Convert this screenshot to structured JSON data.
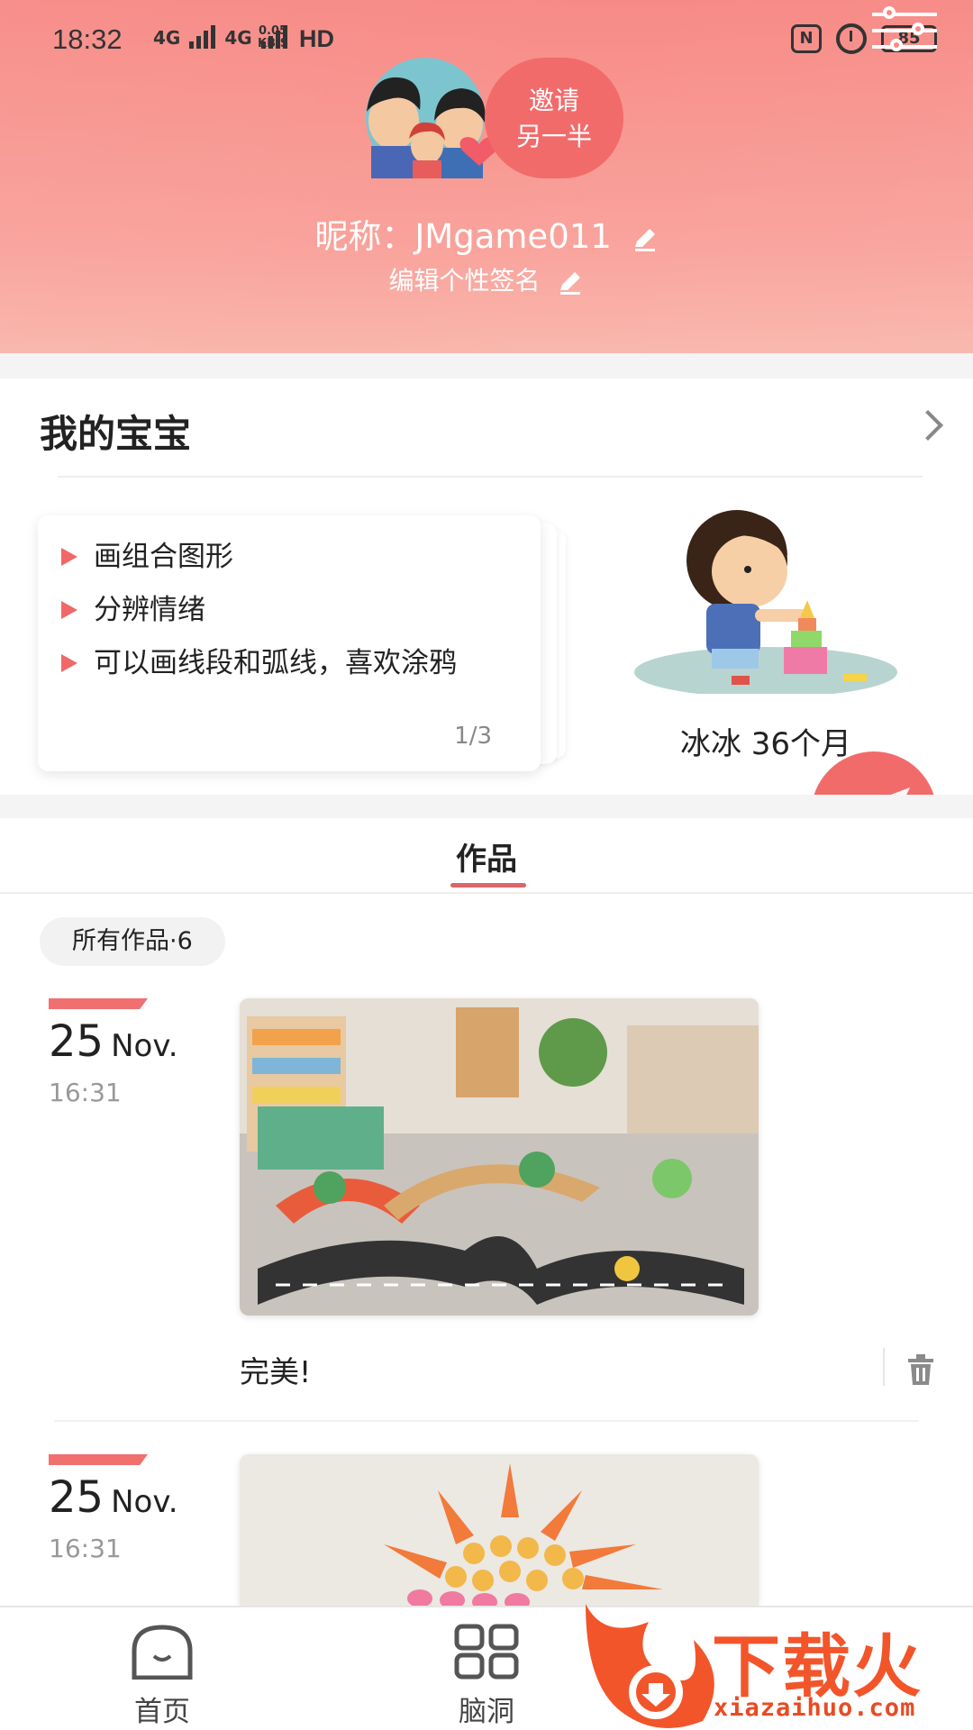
{
  "status_bar": {
    "time": "18:32",
    "network_1": "4G",
    "network_2": "4G",
    "speed_value": "0.05",
    "speed_unit": "KB/S",
    "hd_label": "HD",
    "nfc_label": "N",
    "battery_level": "85"
  },
  "profile": {
    "invite_line1": "邀请",
    "invite_line2": "另一半",
    "nickname": "昵称：JMgame011",
    "signature": "编辑个性签名"
  },
  "baby_section": {
    "title": "我的宝宝",
    "tips": [
      "画组合图形",
      "分辨情绪",
      "可以画线段和弧线，喜欢涂鸦"
    ],
    "tip_page": "1/3",
    "baby_name": "冰冰 36个月"
  },
  "tabs": {
    "works": "作品"
  },
  "works": {
    "filter_label": "所有作品·6",
    "entries": [
      {
        "day": "25",
        "month": "Nov.",
        "time": "16:31",
        "caption": "完美!"
      },
      {
        "day": "25",
        "month": "Nov.",
        "time": "16:31",
        "caption": ""
      }
    ]
  },
  "bottom_nav": {
    "home": "首页",
    "brain": "脑洞"
  },
  "watermark": {
    "text": "下载火",
    "url": "xiazaihuo.com"
  },
  "colors": {
    "accent": "#f26b6b",
    "header_top": "#f78a86",
    "header_bottom": "#f9b6ac",
    "watermark": "#f2552a"
  }
}
